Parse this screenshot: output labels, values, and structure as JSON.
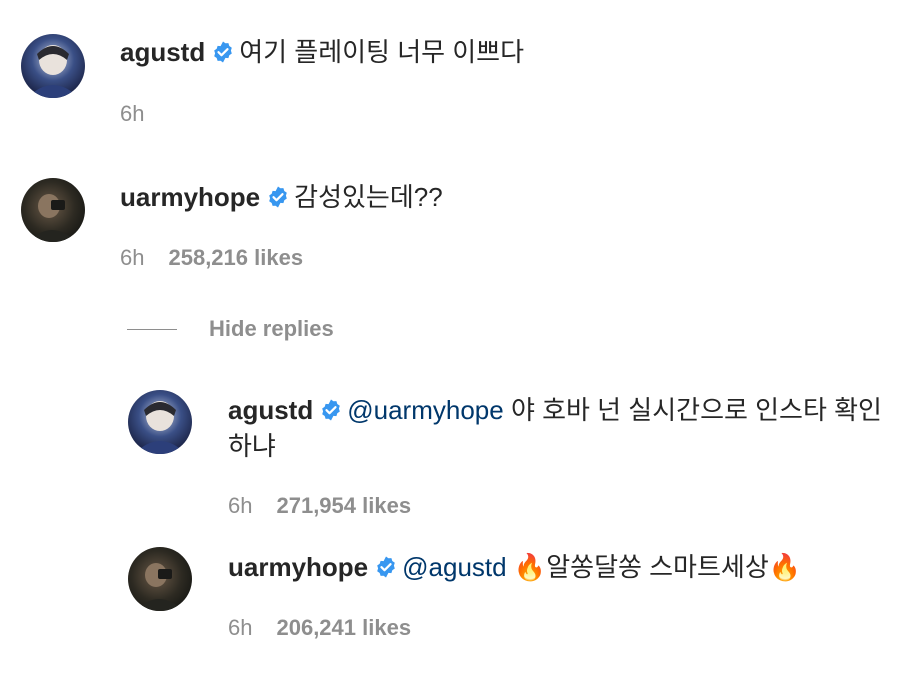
{
  "comments": [
    {
      "username": "agustd",
      "text": "여기 플레이팅 너무 이쁘다",
      "time": "6h"
    },
    {
      "username": "uarmyhope",
      "text": "감성있는데??",
      "time": "6h",
      "likes": "258,216 likes"
    }
  ],
  "hide_replies_label": "Hide replies",
  "replies": [
    {
      "username": "agustd",
      "mention": "@uarmyhope",
      "text": "야 호바 넌 실시간으로 인스타 확인하냐",
      "time": "6h",
      "likes": "271,954 likes"
    },
    {
      "username": "uarmyhope",
      "mention": "@agustd",
      "text": "🔥알쏭달쏭 스마트세상🔥",
      "time": "6h",
      "likes": "206,241 likes"
    }
  ],
  "icons": {
    "verified": "verified-badge-icon",
    "verified_color": "#3897f0"
  }
}
